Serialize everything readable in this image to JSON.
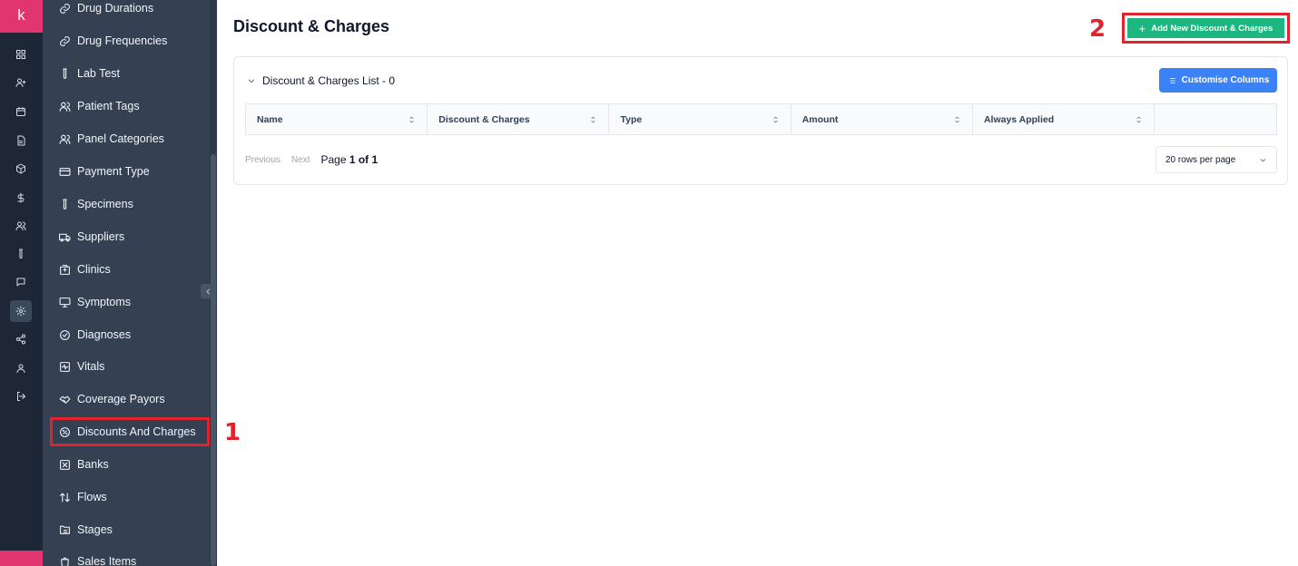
{
  "rail": {
    "logo": "k"
  },
  "sidebar": {
    "items": [
      {
        "label": "Drug Durations",
        "icon": "link-icon"
      },
      {
        "label": "Drug Frequencies",
        "icon": "link-icon"
      },
      {
        "label": "Lab Test",
        "icon": "test-tube-icon"
      },
      {
        "label": "Patient Tags",
        "icon": "users-icon"
      },
      {
        "label": "Panel Categories",
        "icon": "users-icon"
      },
      {
        "label": "Payment Type",
        "icon": "credit-card-icon"
      },
      {
        "label": "Specimens",
        "icon": "test-tube-icon"
      },
      {
        "label": "Suppliers",
        "icon": "truck-icon"
      },
      {
        "label": "Clinics",
        "icon": "hospital-icon"
      },
      {
        "label": "Symptoms",
        "icon": "monitor-icon"
      },
      {
        "label": "Diagnoses",
        "icon": "check-circle-icon"
      },
      {
        "label": "Vitals",
        "icon": "activity-square-icon"
      },
      {
        "label": "Coverage Payors",
        "icon": "handshake-icon"
      },
      {
        "label": "Discounts And Charges",
        "icon": "badge-percent-icon"
      },
      {
        "label": "Banks",
        "icon": "square-x-icon"
      },
      {
        "label": "Flows",
        "icon": "arrow-up-down-icon"
      },
      {
        "label": "Stages",
        "icon": "folder-tree-icon"
      },
      {
        "label": "Sales Items",
        "icon": "shopping-bag-icon"
      }
    ]
  },
  "annotations": {
    "one": "1",
    "two": "2"
  },
  "main": {
    "title": "Discount & Charges",
    "add_button": "Add New Discount & Charges",
    "list_title": "Discount & Charges List - 0",
    "customise_button": "Customise Columns",
    "columns": [
      "Name",
      "Discount & Charges",
      "Type",
      "Amount",
      "Always Applied"
    ],
    "pager": {
      "previous": "Previous",
      "next": "Next",
      "page_prefix": "Page",
      "page_current": "1 of 1",
      "rows_per_page": "20 rows per page"
    }
  },
  "colors": {
    "brand": "#e0356f",
    "sidebar_bg": "#354153",
    "rail_bg": "#1e2736",
    "add_button": "#1cb77f",
    "customise_button": "#3b82f6",
    "annotation": "#e0232d"
  }
}
